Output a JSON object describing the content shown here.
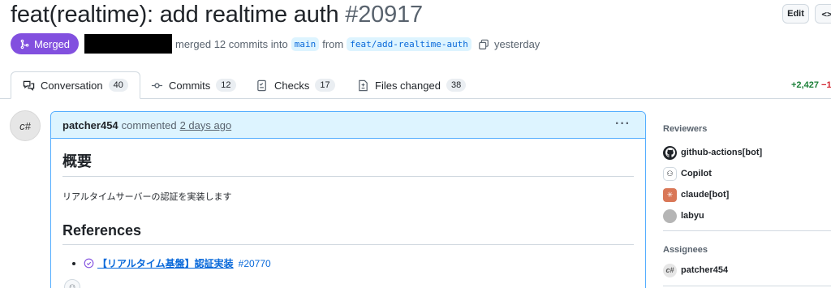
{
  "pr": {
    "title": "feat(realtime): add realtime auth",
    "number": "#20917",
    "state": "Merged",
    "merge_text": "merged 12 commits into",
    "base_branch": "main",
    "from_text": "from",
    "head_branch": "feat/add-realtime-auth",
    "time": "yesterday"
  },
  "header_buttons": {
    "edit": "Edit",
    "code": "<>"
  },
  "tabs": [
    {
      "label": "Conversation",
      "count": "40",
      "icon": "comment-discussion-icon"
    },
    {
      "label": "Commits",
      "count": "12",
      "icon": "git-commit-icon"
    },
    {
      "label": "Checks",
      "count": "17",
      "icon": "checklist-icon"
    },
    {
      "label": "Files changed",
      "count": "38",
      "icon": "file-diff-icon"
    }
  ],
  "diffstat": {
    "additions": "+2,427",
    "deletions": "−1"
  },
  "comment": {
    "avatar_text": "c#",
    "author": "patcher454",
    "action": "commented",
    "when": "2 days ago",
    "menu": "···",
    "heading1": "概要",
    "paragraph": "リアルタイムサーバーの認証を実装します",
    "heading2": "References",
    "ref_link": "【リアルタイム基盤】認証実装",
    "ref_number": "#20770"
  },
  "sidebar": {
    "reviewers_title": "Reviewers",
    "reviewers": [
      {
        "name": "github-actions[bot]",
        "avatar": ""
      },
      {
        "name": "Copilot",
        "avatar": "⚇"
      },
      {
        "name": "claude[bot]",
        "avatar": "✳"
      },
      {
        "name": "labyu",
        "avatar": ""
      }
    ],
    "assignees_title": "Assignees",
    "assignees": [
      {
        "name": "patcher454",
        "avatar": "c#"
      }
    ]
  },
  "colors": {
    "merged": "#8250df",
    "link": "#0969da",
    "comment_border": "#54aeff",
    "comment_header": "#ddf4ff"
  }
}
